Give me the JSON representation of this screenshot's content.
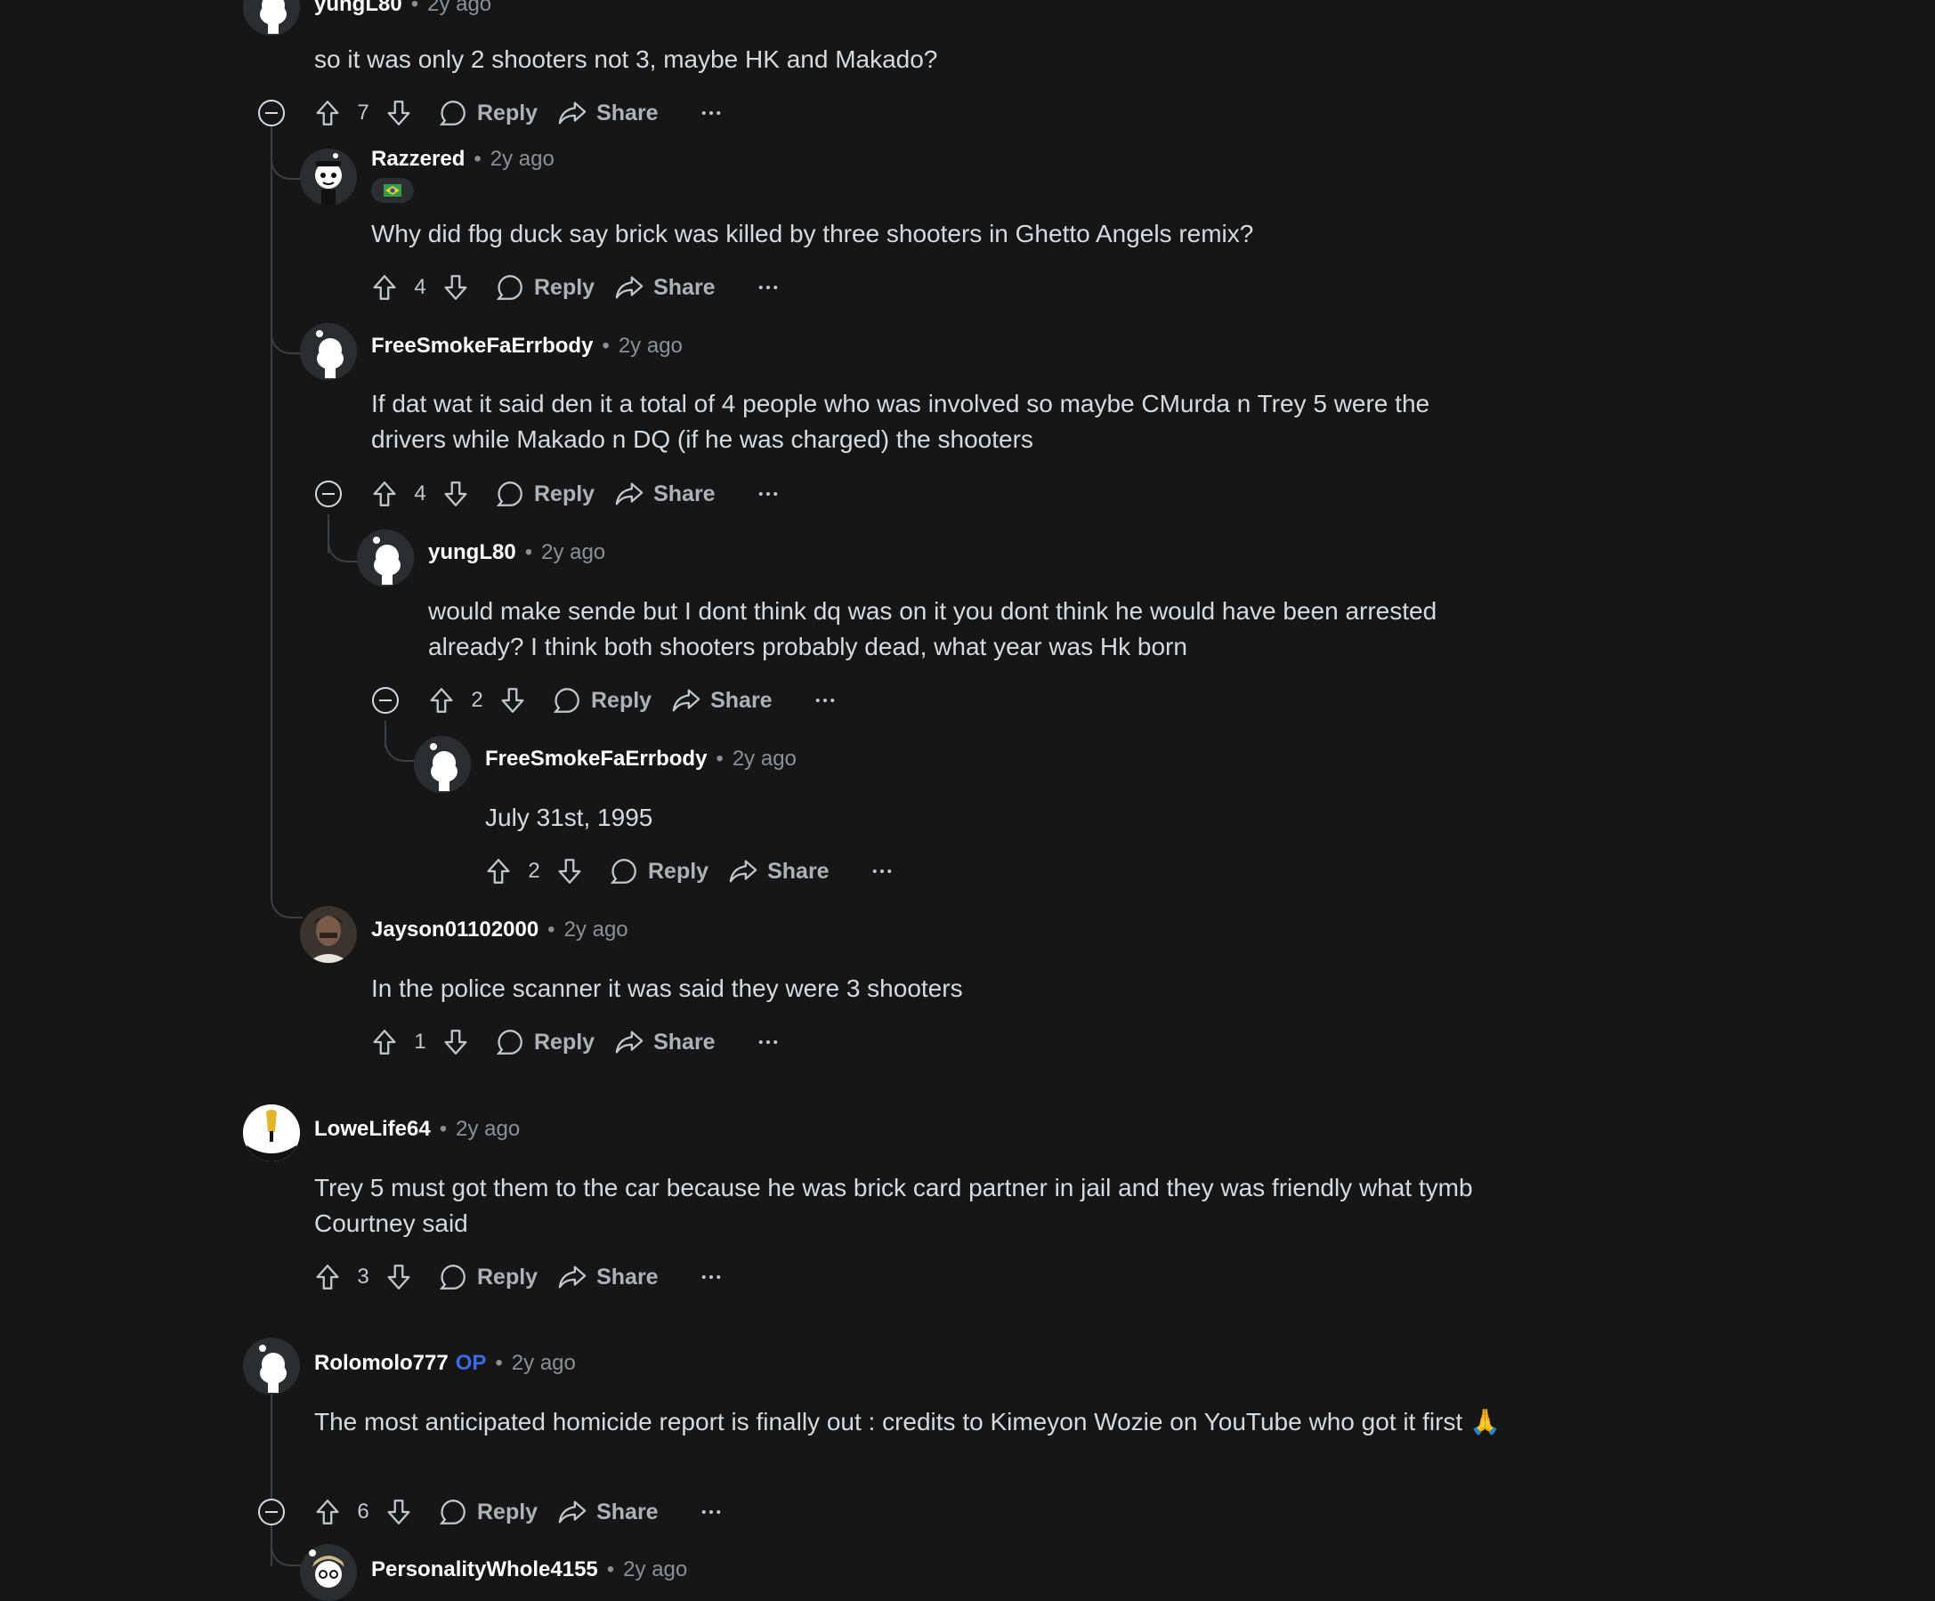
{
  "labels": {
    "reply": "Reply",
    "share": "Share",
    "op_badge": "OP",
    "separator": "•"
  },
  "comments": [
    {
      "author": "yungL80",
      "time": "2y ago",
      "body": "so it was only 2 shooters not 3, maybe HK and Makado?",
      "score": "7"
    },
    {
      "author": "Razzered",
      "time": "2y ago",
      "flair_icon": "brazil-flag-icon",
      "body": "Why did fbg duck say brick was killed by three shooters in Ghetto Angels remix?",
      "score": "4"
    },
    {
      "author": "FreeSmokeFaErrbody",
      "time": "2y ago",
      "body": "If dat wat it said den it a total of 4 people who was involved so maybe CMurda n Trey 5 were the drivers while Makado n DQ (if he was charged) the shooters",
      "score": "4"
    },
    {
      "author": "yungL80",
      "time": "2y ago",
      "body": "would make sende but I dont think dq was on it you dont think he would have been arrested already? I think both shooters probably dead, what year was Hk born",
      "score": "2"
    },
    {
      "author": "FreeSmokeFaErrbody",
      "time": "2y ago",
      "body": "July 31st, 1995",
      "score": "2"
    },
    {
      "author": "Jayson01102000",
      "time": "2y ago",
      "body": "In the police scanner it was said they were 3 shooters",
      "score": "1"
    },
    {
      "author": "LoweLife64",
      "time": "2y ago",
      "body": "Trey 5 must got them to the car because he was brick card partner in jail and they was friendly what tymb Courtney said",
      "score": "3"
    },
    {
      "author": "Rolomolo777",
      "time": "2y ago",
      "body": "The most anticipated homicide report is finally out : credits to Kimeyon Wozie on YouTube who got it first 🙏",
      "score": "6"
    },
    {
      "author": "PersonalityWhole4155",
      "time": "2y ago"
    }
  ],
  "colors": {
    "background": "#161617",
    "text": "#d7dadc",
    "muted": "#8c9094",
    "op": "#3c6be8",
    "thread_line": "#3c3f41"
  }
}
